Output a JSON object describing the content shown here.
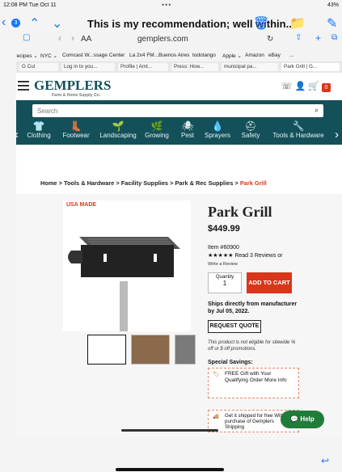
{
  "status_bar": {
    "time": "12:08 PM  Tue Oct 11",
    "battery": "43%"
  },
  "mail_header": {
    "count": "3",
    "title": "This is my recommendation; well within..."
  },
  "safari": {
    "aa": "AA",
    "address": "gemplers.com",
    "bookmarks": [
      "Recipes ⌄",
      "NYC ⌄",
      "Comcast W...ssage Center",
      "La 2x4 FM...Buenos Aires",
      "todotango",
      "Apple ⌄",
      "Amazon",
      "eBay",
      "..."
    ],
    "tabs": [
      "G Cul",
      "Log in to you...",
      "Profile | Amt...",
      "Press: How...",
      "municipal pa...",
      "Park Grill | G..."
    ]
  },
  "site": {
    "logo": "GEMPLERS",
    "logo_tag": "Farm & Home Supply Co.",
    "cart_count": "0",
    "search_placeholder": "Search",
    "categories": [
      {
        "label": "Clothing",
        "icon": "👕"
      },
      {
        "label": "Footwear",
        "icon": "👢"
      },
      {
        "label": "Landscaping",
        "icon": "🌱"
      },
      {
        "label": "Growing",
        "icon": "🌿"
      },
      {
        "label": "Pest",
        "icon": "🕷"
      },
      {
        "label": "Sprayers",
        "icon": "💧"
      },
      {
        "label": "Safety",
        "icon": "⛑"
      },
      {
        "label": "Tools & Hardware",
        "icon": "🔧"
      }
    ],
    "breadcrumb": [
      "Home",
      "Tools & Hardware",
      "Facility Supplies",
      "Park & Rec Supplies",
      "Park Grill"
    ]
  },
  "product": {
    "badge": "USA MADE",
    "name": "Park Grill",
    "price": "$449.99",
    "item": "Item #60900",
    "rating_text": "Read 3 Reviews or",
    "write_review": "Write a Review",
    "quantity_label": "Quantity",
    "quantity_value": "1",
    "add_to_cart": "ADD TO CART",
    "shipping": "Ships directly from manufacturer by Jul 05, 2022.",
    "request_quote": "REQUEST QUOTE",
    "note": "This product is not eligible for sitewide % off or $ off promotions.",
    "special_savings": "Special Savings:",
    "gift": "FREE Gift with Your Qualifying Order More Info",
    "ship_offer": "Get it shipped for free With purchase of Gemplers Shipping"
  },
  "help": "Help"
}
